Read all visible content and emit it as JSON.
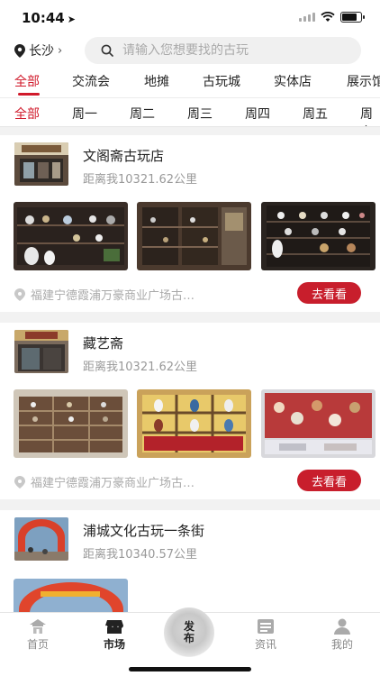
{
  "status_bar": {
    "time": "10:44"
  },
  "header": {
    "location": "长沙",
    "search_placeholder": "请输入您想要找的古玩"
  },
  "category_tabs": [
    "全部",
    "交流会",
    "地摊",
    "古玩城",
    "实体店",
    "展示馆"
  ],
  "day_tabs": [
    "全部",
    "周一",
    "周二",
    "周三",
    "周四",
    "周五",
    "周六"
  ],
  "stores": [
    {
      "name": "文阁斋古玩店",
      "distance": "距离我10321.62公里",
      "address": "福建宁德霞浦万豪商业广场古…",
      "button": "去看看"
    },
    {
      "name": "藏艺斋",
      "distance": "距离我10321.62公里",
      "address": "福建宁德霞浦万豪商业广场古…",
      "button": "去看看"
    },
    {
      "name": "浦城文化古玩一条街",
      "distance": "距离我10340.57公里"
    }
  ],
  "tabbar": {
    "home": "首页",
    "market": "市场",
    "publish": "发布",
    "news": "资讯",
    "mine": "我的"
  },
  "colors": {
    "accent": "#c81e2c",
    "active_tab": "#d0192a"
  }
}
